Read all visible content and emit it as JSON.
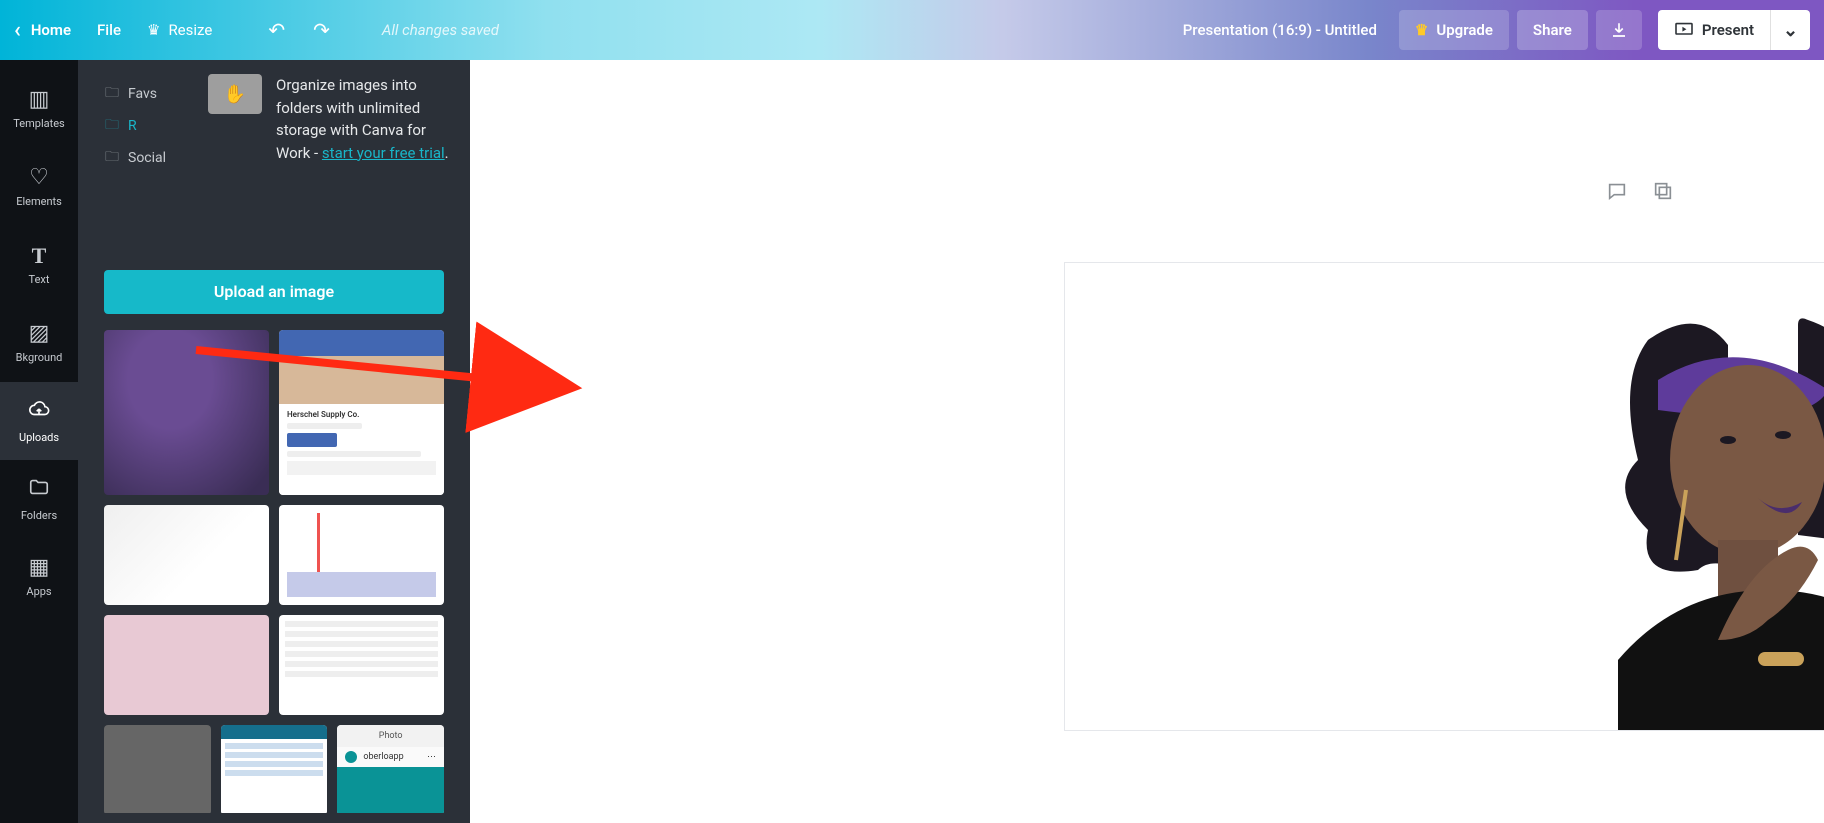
{
  "topbar": {
    "home": "Home",
    "file": "File",
    "resize": "Resize",
    "saved": "All changes saved",
    "doc_title": "Presentation (16:9) - Untitled",
    "upgrade": "Upgrade",
    "share": "Share",
    "present": "Present"
  },
  "rail": {
    "templates": "Templates",
    "elements": "Elements",
    "text": "Text",
    "background": "Bkground",
    "uploads": "Uploads",
    "folders": "Folders",
    "apps": "Apps"
  },
  "panel": {
    "folders": {
      "favs": "Favs",
      "selected": "R",
      "social": "Social"
    },
    "promo_text_1": "Organize images into folders with unlimited storage with Canva for Work - ",
    "promo_link": "start your free trial",
    "promo_dot": ".",
    "upload_label": "Upload an image",
    "thumb_fb_title": "Herschel Supply Co.",
    "thumb_ig_title": "Photo",
    "thumb_ig_user": "oberloapp"
  },
  "icons": {
    "chev_left": "‹",
    "chev_down": "⌄",
    "undo": "↶",
    "redo": "↷",
    "crown": "♛",
    "download": "↓",
    "play": "▸",
    "folder": "🗀",
    "cloud": "☁",
    "grid": "▦",
    "shapes": "♡",
    "layout": "▥",
    "text_t": "T",
    "texture": "▨",
    "comment": "💬",
    "duplicate": "⧉"
  }
}
